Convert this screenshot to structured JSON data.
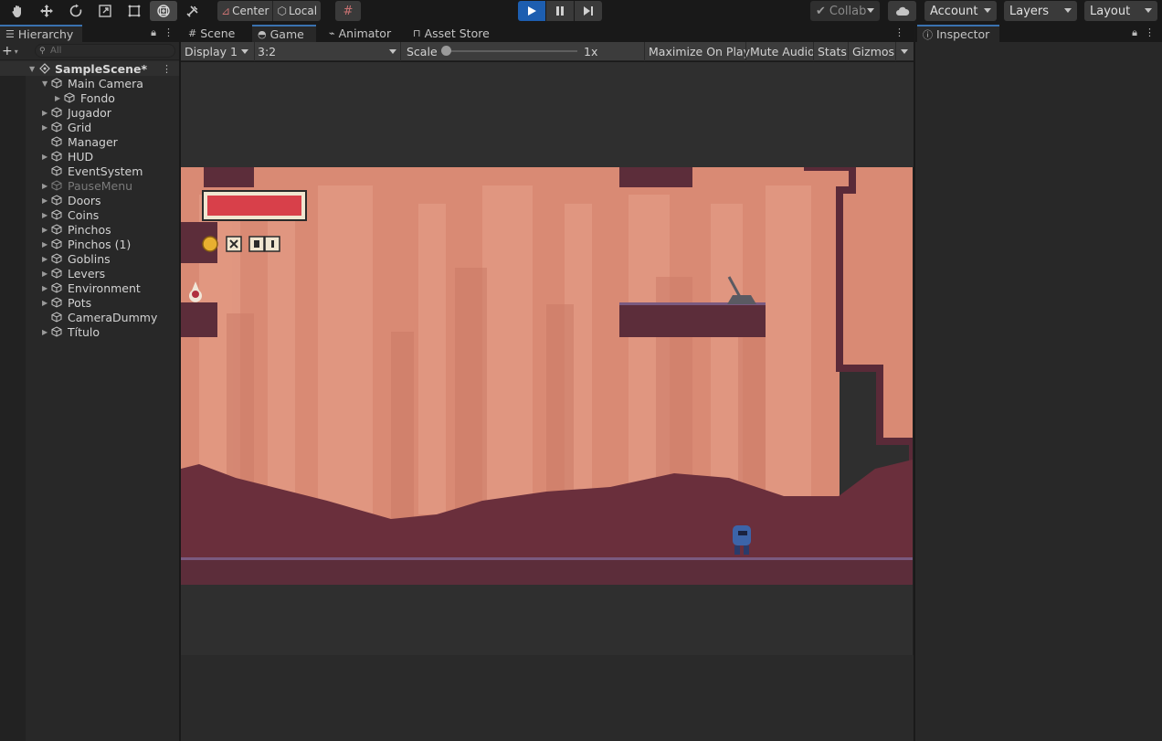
{
  "toolbar": {
    "tools": [
      "hand-tool",
      "move-tool",
      "rotate-tool",
      "scale-tool",
      "rect-tool",
      "transform-tool",
      "custom-tool"
    ],
    "pivot_mode": "Center",
    "pivot_rotation": "Local",
    "collab": "Collab",
    "account": "Account",
    "layers": "Layers",
    "layout": "Layout"
  },
  "hierarchy": {
    "tab_label": "Hierarchy",
    "search_placeholder": "All",
    "scene_name": "SampleScene*",
    "items": [
      {
        "label": "Main Camera",
        "depth": 1,
        "arrow": "expanded"
      },
      {
        "label": "Fondo",
        "depth": 2,
        "arrow": "collapsed"
      },
      {
        "label": "Jugador",
        "depth": 1,
        "arrow": "collapsed"
      },
      {
        "label": "Grid",
        "depth": 1,
        "arrow": "collapsed"
      },
      {
        "label": "Manager",
        "depth": 1,
        "arrow": "none"
      },
      {
        "label": "HUD",
        "depth": 1,
        "arrow": "collapsed"
      },
      {
        "label": "EventSystem",
        "depth": 1,
        "arrow": "none"
      },
      {
        "label": "PauseMenu",
        "depth": 1,
        "arrow": "collapsed",
        "disabled": true
      },
      {
        "label": "Doors",
        "depth": 1,
        "arrow": "collapsed"
      },
      {
        "label": "Coins",
        "depth": 1,
        "arrow": "collapsed"
      },
      {
        "label": "Pinchos",
        "depth": 1,
        "arrow": "collapsed"
      },
      {
        "label": "Pinchos (1)",
        "depth": 1,
        "arrow": "collapsed"
      },
      {
        "label": "Goblins",
        "depth": 1,
        "arrow": "collapsed"
      },
      {
        "label": "Levers",
        "depth": 1,
        "arrow": "collapsed"
      },
      {
        "label": "Environment",
        "depth": 1,
        "arrow": "collapsed"
      },
      {
        "label": "Pots",
        "depth": 1,
        "arrow": "collapsed"
      },
      {
        "label": "CameraDummy",
        "depth": 1,
        "arrow": "none"
      },
      {
        "label": "Título",
        "depth": 1,
        "arrow": "collapsed"
      }
    ]
  },
  "center_tabs": [
    {
      "label": "Scene",
      "icon": "grid-icon"
    },
    {
      "label": "Game",
      "icon": "gamepad-icon",
      "active": true
    },
    {
      "label": "Animator",
      "icon": "animator-icon"
    },
    {
      "label": "Asset Store",
      "icon": "store-icon"
    }
  ],
  "game_toolbar": {
    "display": "Display 1",
    "aspect": "3:2",
    "scale_label": "Scale",
    "scale_value": "1x",
    "maximize": "Maximize On Play",
    "mute": "Mute Audio",
    "stats": "Stats",
    "gizmos": "Gizmos"
  },
  "game_hud": {
    "health_fraction": 1.0,
    "icons": [
      "coin-icon",
      "multiply-icon",
      "zero-digit-icon",
      "one-digit-icon"
    ]
  },
  "inspector": {
    "tab_label": "Inspector"
  },
  "colors": {
    "accent_blue": "#3a72b0",
    "play_active": "#1d5eb0",
    "sky": "#d98a74",
    "ground": "#6a2f3c",
    "health_red": "#d8404a"
  }
}
